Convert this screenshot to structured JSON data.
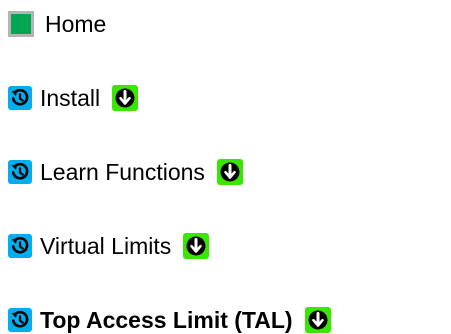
{
  "colors": {
    "home_square": "#00a651",
    "home_square_border": "#b4b4b4",
    "cycle_icon_bg": "#00aeef",
    "down_icon_bg": "#39e600"
  },
  "nav": {
    "items": [
      {
        "label": "Home",
        "icon": "home-square-icon"
      },
      {
        "label": "Install",
        "icon": "cycle-icon",
        "trailing_icon": "down-arrow-icon"
      },
      {
        "label": "Learn Functions",
        "icon": "cycle-icon",
        "trailing_icon": "down-arrow-icon"
      },
      {
        "label": "Virtual Limits",
        "icon": "cycle-icon",
        "trailing_icon": "down-arrow-icon"
      },
      {
        "label": "Top Access Limit (TAL)",
        "icon": "cycle-icon",
        "trailing_icon": "down-arrow-icon",
        "active": true
      }
    ]
  }
}
